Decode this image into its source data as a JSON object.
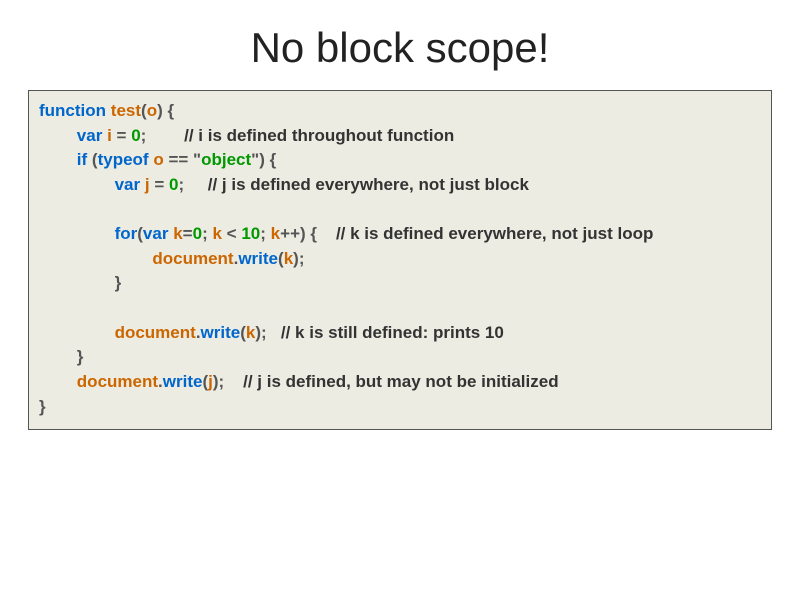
{
  "title": "No block scope!",
  "code": {
    "l1": {
      "kw1": "function",
      "fn": "test",
      "p1": "(",
      "id1": "o",
      "p2": ")",
      "sp1": " ",
      "p3": "{"
    },
    "l2": {
      "indent": "        ",
      "kw1": "var",
      "sp1": " ",
      "id1": "i",
      "sp2": " ",
      "op1": "=",
      "sp3": " ",
      "num1": "0",
      "p1": ";",
      "sp4": "        ",
      "cmt": "// i is defined throughout function"
    },
    "l3": {
      "indent": "        ",
      "kw1": "if",
      "sp1": " ",
      "p1": "(",
      "kw2": "typeof",
      "sp2": " ",
      "id1": "o",
      "sp3": " ",
      "op1": "==",
      "sp4": " ",
      "q1": "\"",
      "str": "object",
      "q2": "\"",
      "p2": ")",
      "sp5": " ",
      "p3": "{"
    },
    "l4": {
      "indent": "                ",
      "kw1": "var",
      "sp1": " ",
      "id1": "j",
      "sp2": " ",
      "op1": "=",
      "sp3": " ",
      "num1": "0",
      "p1": ";",
      "sp4": "     ",
      "cmt": "// j is defined everywhere, not just block"
    },
    "l5": {
      "blank": ""
    },
    "l6": {
      "indent": "                ",
      "kw1": "for",
      "p1": "(",
      "kw2": "var",
      "sp1": " ",
      "id1": "k",
      "op1": "=",
      "num1": "0",
      "p2": ";",
      "sp2": " ",
      "id2": "k",
      "sp3": " ",
      "op2": "<",
      "sp4": " ",
      "num2": "10",
      "p3": ";",
      "sp5": " ",
      "id3": "k",
      "op3": "++",
      "p4": ")",
      "sp6": " ",
      "p5": "{",
      "sp7": "    ",
      "cmt": "// k is defined everywhere, not just loop"
    },
    "l7": {
      "indent": "                        ",
      "id1": "document",
      "dot": ".",
      "mth": "write",
      "p1": "(",
      "id2": "k",
      "p2": ")",
      "p3": ";"
    },
    "l8": {
      "indent": "                ",
      "p1": "}"
    },
    "l9": {
      "blank": ""
    },
    "l10": {
      "indent": "                ",
      "id1": "document",
      "dot": ".",
      "mth": "write",
      "p1": "(",
      "id2": "k",
      "p2": ")",
      "p3": ";",
      "sp1": "   ",
      "cmt": "// k is still defined: prints 10"
    },
    "l11": {
      "indent": "        ",
      "p1": "}"
    },
    "l12": {
      "indent": "        ",
      "id1": "document",
      "dot": ".",
      "mth": "write",
      "p1": "(",
      "id2": "j",
      "p2": ")",
      "p3": ";",
      "sp1": "    ",
      "cmt": "// j is defined, but may not be initialized"
    },
    "l13": {
      "p1": "}"
    }
  }
}
